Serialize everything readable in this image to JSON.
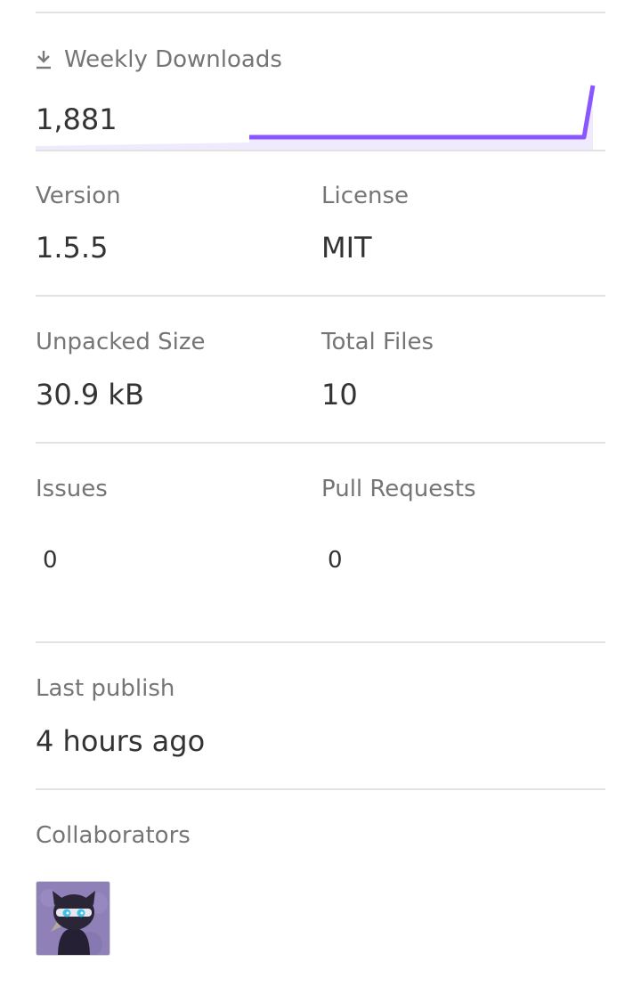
{
  "downloads": {
    "title": "Weekly Downloads",
    "count": "1,881",
    "accent": "#8956ff",
    "accent_fill": "#f0eafd",
    "icon": "download-icon"
  },
  "stats": {
    "version": {
      "label": "Version",
      "value": "1.5.5"
    },
    "license": {
      "label": "License",
      "value": "MIT"
    },
    "unpacked_size": {
      "label": "Unpacked Size",
      "value": "30.9 kB"
    },
    "total_files": {
      "label": "Total Files",
      "value": "10"
    },
    "issues": {
      "label": "Issues",
      "value": "0"
    },
    "pull_requests": {
      "label": "Pull Requests",
      "value": "0"
    },
    "last_publish": {
      "label": "Last publish",
      "value": "4 hours ago"
    }
  },
  "collaborators": {
    "label": "Collaborators",
    "avatar_icon": "ninja-cat-avatar"
  }
}
